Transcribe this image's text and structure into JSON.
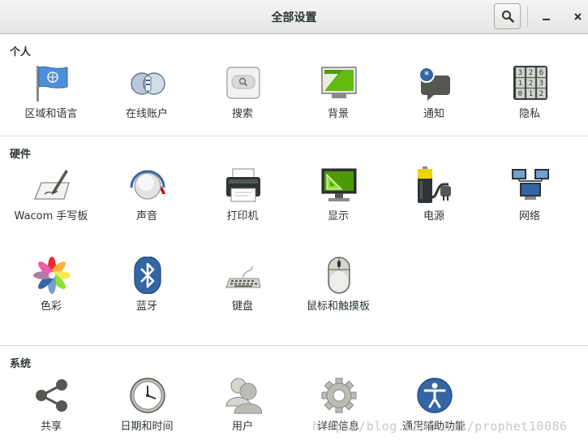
{
  "window": {
    "title": "全部设置"
  },
  "sections": {
    "personal": {
      "title": "个人",
      "items": [
        "区域和语言",
        "在线账户",
        "搜索",
        "背景",
        "通知",
        "隐私"
      ]
    },
    "hardware": {
      "title": "硬件",
      "items": [
        "Wacom 手写板",
        "声音",
        "打印机",
        "显示",
        "电源",
        "网络",
        "色彩",
        "蓝牙",
        "键盘",
        "鼠标和触摸板"
      ]
    },
    "system": {
      "title": "系统",
      "items": [
        "共享",
        "日期和时间",
        "用户",
        "详细信息",
        "通用辅助功能"
      ]
    }
  },
  "lock_digits": [
    "3",
    "2",
    "6",
    "1",
    "2",
    "3",
    "0",
    "1",
    "2"
  ],
  "watermark": "http://blog.csdn.net/prophet10086",
  "colors": {
    "accent": "#3465a4",
    "text": "#2e3436"
  }
}
